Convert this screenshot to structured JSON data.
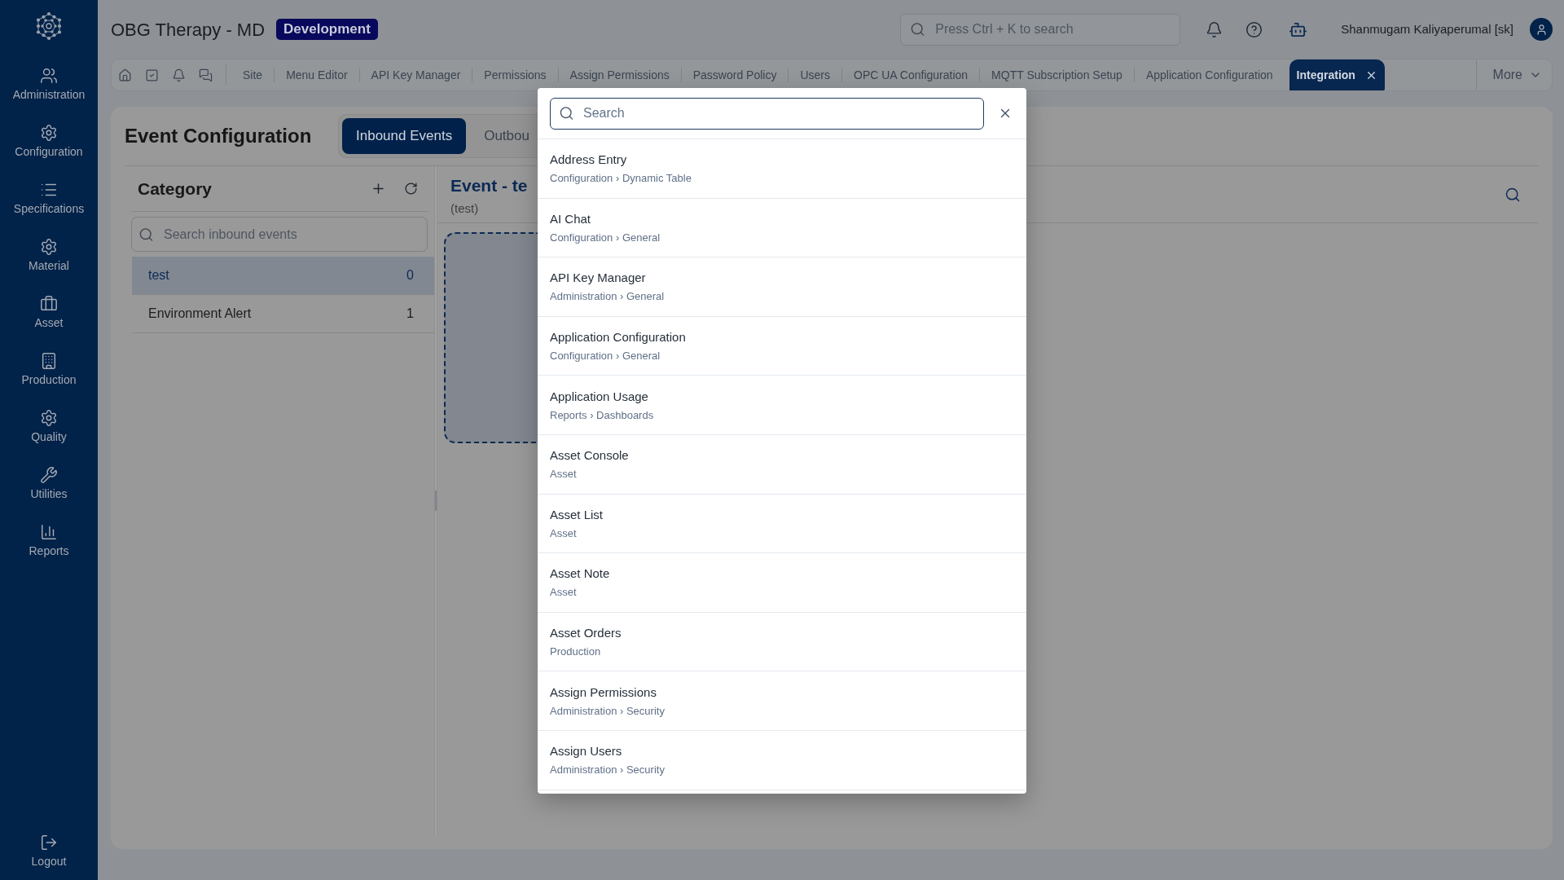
{
  "sidebar": {
    "items": [
      {
        "label": "Administration"
      },
      {
        "label": "Configuration"
      },
      {
        "label": "Specifications"
      },
      {
        "label": "Material"
      },
      {
        "label": "Asset"
      },
      {
        "label": "Production"
      },
      {
        "label": "Quality"
      },
      {
        "label": "Utilities"
      },
      {
        "label": "Reports"
      }
    ],
    "logout": {
      "label": "Logout"
    }
  },
  "header": {
    "title": "OBG Therapy - MD",
    "environment": "Development",
    "search": {
      "placeholder": "Press Ctrl + K to search"
    },
    "user": {
      "name": "Shanmugam Kaliyaperumal [sk]"
    }
  },
  "open_tabs": {
    "tabs": [
      {
        "label": "Site",
        "selected": false
      },
      {
        "label": "Menu Editor",
        "selected": false
      },
      {
        "label": "API Key Manager",
        "selected": false
      },
      {
        "label": "Permissions",
        "selected": false
      },
      {
        "label": "Assign Permissions",
        "selected": false
      },
      {
        "label": "Password Policy",
        "selected": false
      },
      {
        "label": "Users",
        "selected": false
      },
      {
        "label": "OPC UA Configuration",
        "selected": false
      },
      {
        "label": "MQTT Subscription Setup",
        "selected": false
      },
      {
        "label": "Application Configuration",
        "selected": false
      },
      {
        "label": "Integration",
        "selected": true
      }
    ],
    "more": {
      "label": "More"
    }
  },
  "page": {
    "title": "Event Configuration",
    "view_tabs": [
      {
        "label": "Inbound Events",
        "selected": true
      },
      {
        "label": "Outbou",
        "selected": false
      }
    ],
    "category_panel": {
      "title": "Category",
      "search": {
        "placeholder": "Search inbound events"
      },
      "items": [
        {
          "name": "test",
          "count": "0",
          "selected": true
        },
        {
          "name": "Environment Alert",
          "count": "1",
          "selected": false
        }
      ]
    },
    "event_panel": {
      "title": "Event - te",
      "subtitle": "(test)"
    }
  },
  "search_dialog": {
    "search": {
      "placeholder": "Search"
    },
    "results": [
      {
        "title": "Address Entry",
        "path": "Configuration › Dynamic Table"
      },
      {
        "title": "AI Chat",
        "path": "Configuration › General"
      },
      {
        "title": "API Key Manager",
        "path": "Administration › General"
      },
      {
        "title": "Application Configuration",
        "path": "Configuration › General"
      },
      {
        "title": "Application Usage",
        "path": "Reports › Dashboards"
      },
      {
        "title": "Asset Console",
        "path": "Asset"
      },
      {
        "title": "Asset List",
        "path": "Asset"
      },
      {
        "title": "Asset Note",
        "path": "Asset"
      },
      {
        "title": "Asset Orders",
        "path": "Production"
      },
      {
        "title": "Assign Permissions",
        "path": "Administration › Security"
      },
      {
        "title": "Assign Users",
        "path": "Administration › Security"
      }
    ]
  }
}
